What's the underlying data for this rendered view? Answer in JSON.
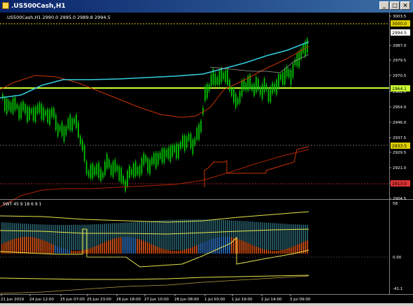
{
  "window": {
    "title": ".US500Cash,H1",
    "buttons": [
      "_",
      "□",
      "×"
    ]
  },
  "chart": {
    "info_line": ".US500Cash,H1  2990.0 2995.0 2989.8 2994.5",
    "price_ticks": [
      "3003.5",
      "2987.0",
      "2979.5",
      "2970.5",
      "2962.0",
      "2954.0",
      "2946.0",
      "2937.5",
      "2929.5",
      "2921.0",
      "2913.0",
      "2904.5"
    ],
    "price_labels": {
      "level_dotted": "3000.0",
      "current_price": "2994.5",
      "horizontal_line": "2964.1",
      "level_lower_dotted": "2933.5",
      "level_bottom_red": "2913.0"
    },
    "indicator": {
      "label": "SWT 45 9 18 6 9 1",
      "ticks": [
        "58",
        "0.00",
        "-41.1"
      ]
    },
    "time_labels": [
      "21 Jun 2019",
      "24 Jun 12:00",
      "25 Jun 07:00",
      "25 Jun 23:00",
      "26 Jun 18:00",
      "27 Jun 10:00",
      "28 Jun 08:00",
      "1 Jul 03:00",
      "1 Jul 19:00",
      "2 Jul 14:00",
      "3 Jul 09:00"
    ],
    "colors": {
      "background": "#000000",
      "bull_candle": "#00c000",
      "bear_candle": "#00c000",
      "ma_cyan": "#33ccdd",
      "ma_red": "#cc3300",
      "h_line": "#ccff33",
      "histo_orange": "#ee5511",
      "histo_blue": "#3377cc",
      "histo_teal": "#3a8a9a",
      "band_yellow": "#e6e64c"
    }
  }
}
